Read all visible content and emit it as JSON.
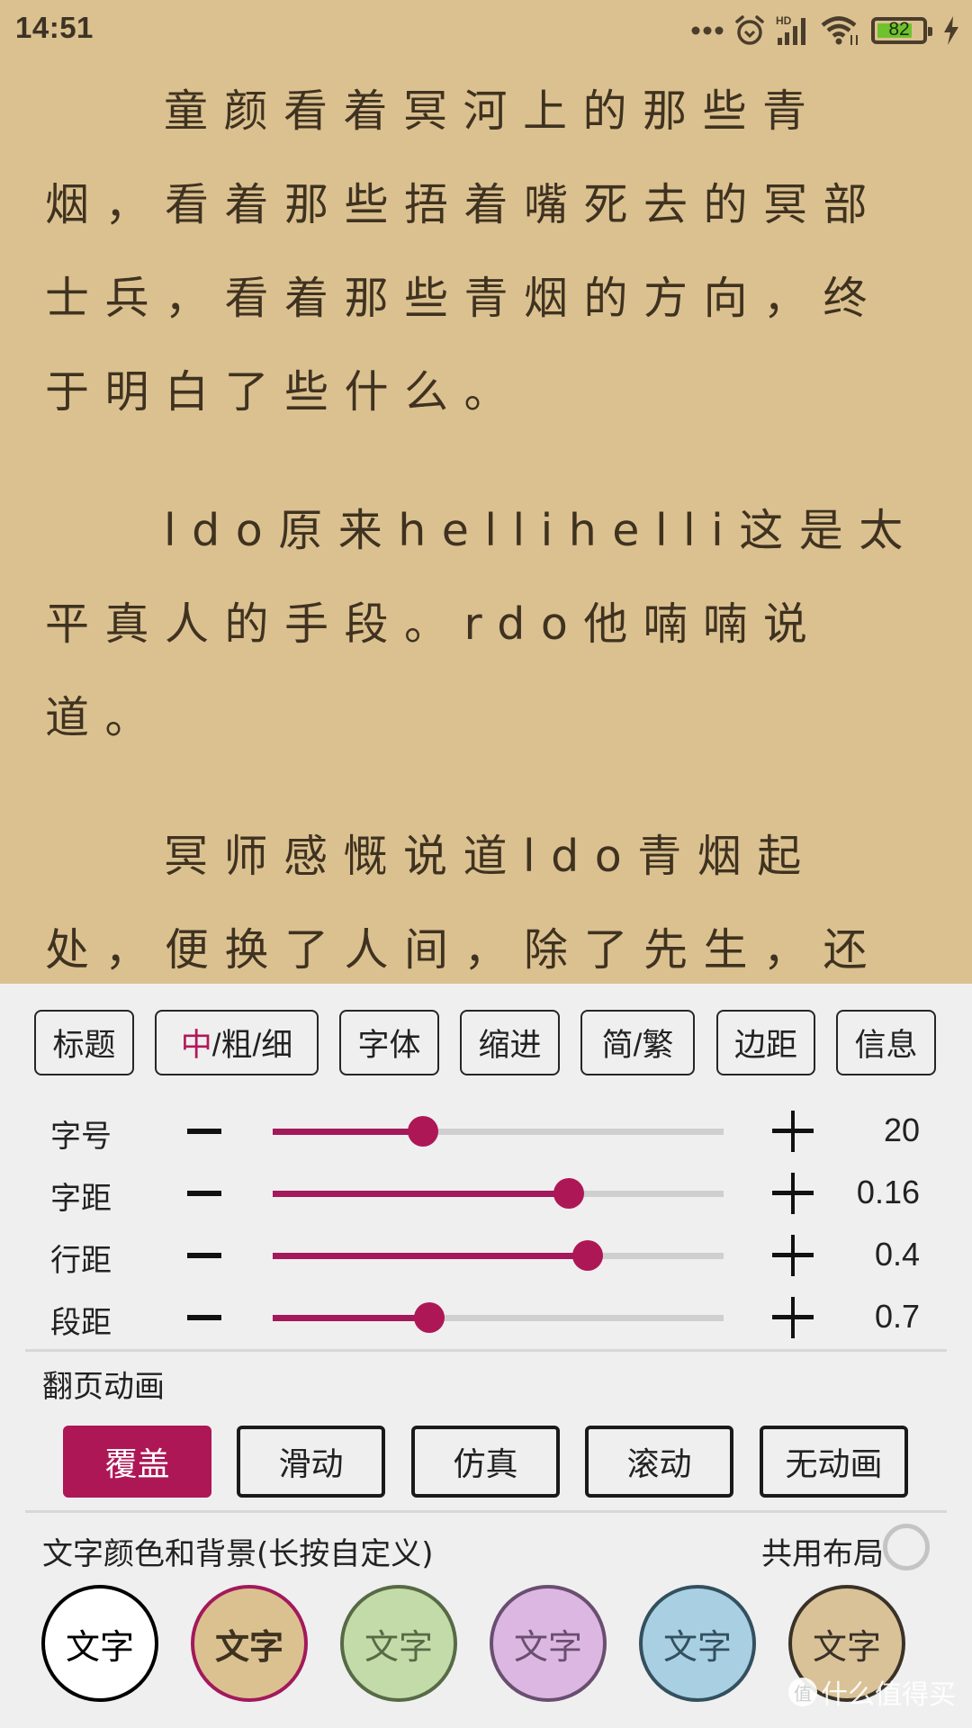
{
  "status_bar": {
    "time": "14:51",
    "icons": [
      "more-dots-icon",
      "alarm-icon",
      "hd-signal-icon",
      "wifi-icon",
      "battery-icon",
      "charging-bolt-icon"
    ],
    "signal_label": "HD",
    "battery_percent": 82,
    "battery_label": "82",
    "battery_color": "#6fc22d"
  },
  "reader": {
    "background_color": "#dbc190",
    "text_color": "#3f3220",
    "paragraphs": [
      "童颜看着冥河上的那些青烟，看着那些捂着嘴死去的冥部士兵，看着那些青烟的方向，终于明白了些什么。",
      "ldo原来hellihelli这是太平真人的手段。rdo他喃喃说道。",
      "冥师感慨说道ldo青烟起处，便换了人间，除了先生，还有谁能成此伟业？rdo"
    ]
  },
  "panel": {
    "accent_color": "#ae1756",
    "toolbar": [
      {
        "label": "标题"
      },
      {
        "label_accent": "中",
        "label_rest": "/粗/细"
      },
      {
        "label": "字体"
      },
      {
        "label": "缩进"
      },
      {
        "label": "简/繁"
      },
      {
        "label": "边距"
      },
      {
        "label": "信息"
      }
    ],
    "sliders": [
      {
        "label": "字号",
        "value": "20",
        "fraction": 0.333
      },
      {
        "label": "字距",
        "value": "0.16",
        "fraction": 0.657
      },
      {
        "label": "行距",
        "value": "0.4",
        "fraction": 0.698
      },
      {
        "label": "段距",
        "value": "0.7",
        "fraction": 0.347
      }
    ],
    "page_animation": {
      "title": "翻页动画",
      "options": [
        "覆盖",
        "滑动",
        "仿真",
        "滚动",
        "无动画"
      ],
      "selected": "覆盖"
    },
    "color_theme": {
      "title": "文字颜色和背景(长按自定义)",
      "share_layout_label": "共用布局",
      "share_layout_checked": false,
      "swatches": [
        {
          "label": "文字",
          "bg": "#ffffff",
          "text": "#000000",
          "border": "#000000",
          "selected": false
        },
        {
          "label": "文字",
          "bg": "#dbc190",
          "text": "#3f3220",
          "border": "#a3195b",
          "selected": true
        },
        {
          "label": "文字",
          "bg": "#c3dba9",
          "text": "#566b45",
          "border": "#566b45",
          "selected": false
        },
        {
          "label": "文字",
          "bg": "#dbb7e1",
          "text": "#6a4e70",
          "border": "#6a4e70",
          "selected": false
        },
        {
          "label": "文字",
          "bg": "#a9cfe3",
          "text": "#33505e",
          "border": "#33505e",
          "selected": false
        },
        {
          "label": "文字",
          "bg": "#d9c297",
          "text": "#3a3228",
          "border": "#3a3228",
          "selected": false
        }
      ]
    }
  },
  "watermark": {
    "logo": "值",
    "text": "什么值得买"
  }
}
